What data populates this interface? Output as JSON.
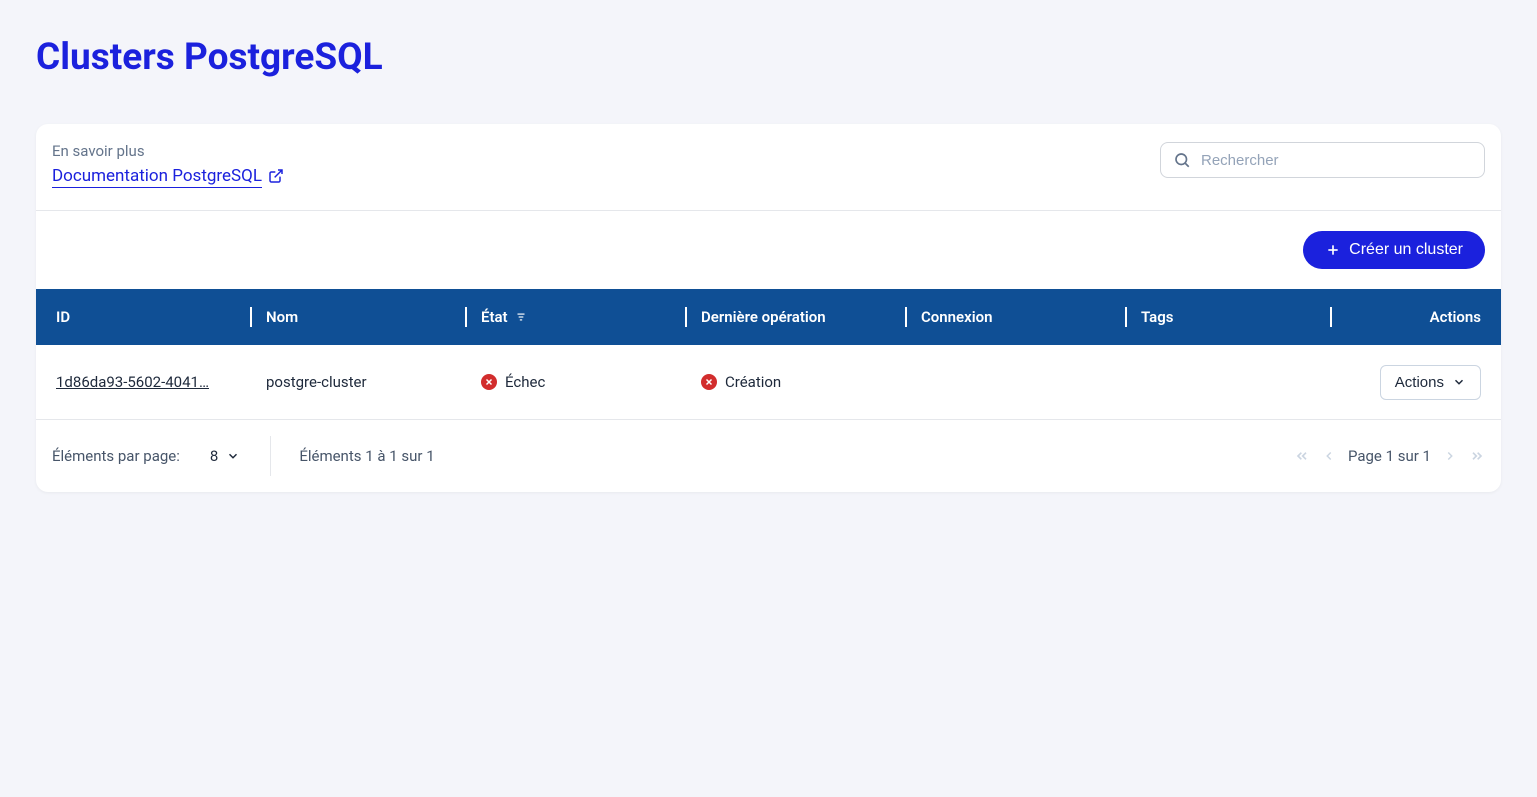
{
  "page": {
    "title": "Clusters PostgreSQL"
  },
  "header": {
    "learn_more": "En savoir plus",
    "doc_link": "Documentation PostgreSQL",
    "search_placeholder": "Rechercher"
  },
  "toolbar": {
    "create_label": "Créer un cluster"
  },
  "table": {
    "headers": {
      "id": "ID",
      "nom": "Nom",
      "etat": "État",
      "op": "Dernière opération",
      "conn": "Connexion",
      "tags": "Tags",
      "actions": "Actions"
    },
    "rows": [
      {
        "id": "1d86da93-5602-4041…",
        "nom": "postgre-cluster",
        "etat": "Échec",
        "op": "Création",
        "conn": "",
        "tags": "",
        "actions_label": "Actions"
      }
    ]
  },
  "pagination": {
    "per_page_label": "Éléments par page:",
    "per_page_value": "8",
    "range": "Éléments 1 à 1 sur 1",
    "page_info": "Page 1 sur 1"
  }
}
